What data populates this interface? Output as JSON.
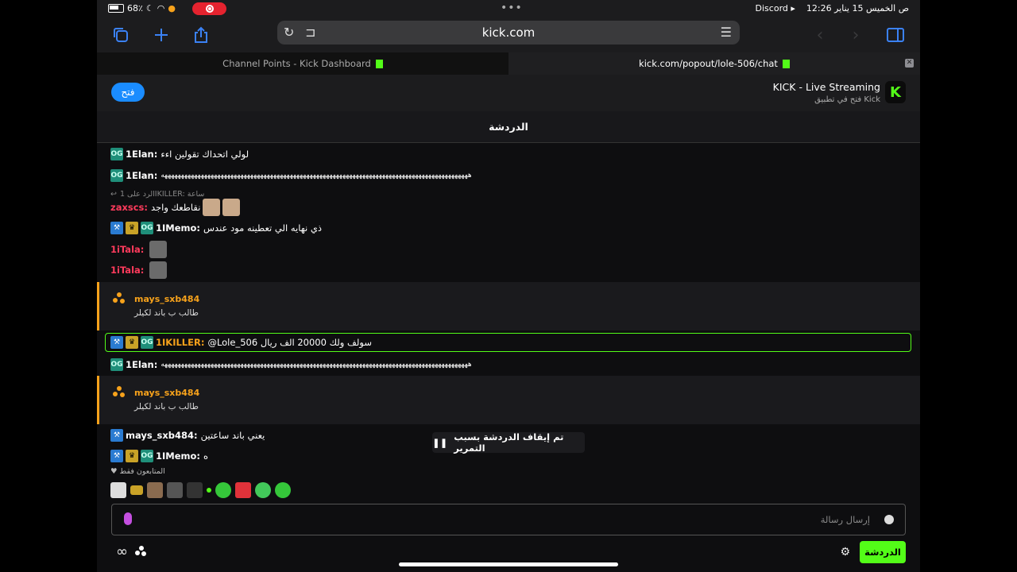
{
  "status": {
    "battery": "68٪",
    "time_date": "12:26 ص الخميس 15 يناير",
    "back_app": "Discord ▸",
    "dots": "•••"
  },
  "browser": {
    "url": "kick.com",
    "tabs": [
      "Channel Points - Kick Dashboard",
      "kick.com/popout/lole-506/chat"
    ],
    "tab_close": "✕"
  },
  "banner": {
    "open_label": "فتح",
    "title": "KICK - Live Streaming",
    "subtitle": "فتح في تطبيق Kick",
    "logo_letter": "K"
  },
  "chat": {
    "title": "الدردشة",
    "messages": [
      {
        "user": "1Elan:",
        "text": "لولي اتحداك تقولين اءء"
      },
      {
        "user": "1Elan:",
        "text": "هههههههههههههههههههههههههههههههههههههههههههههههههههههههههههههههههههههههههههههههههههههههههههههه"
      },
      {
        "reply": "الرد على 1IKILLER: ساعة",
        "user": "zaxscs:",
        "text": "نقاطعك واجد"
      },
      {
        "user": "1IMemo:",
        "text": "ذي نهايه الي تعطينه مود عندس"
      },
      {
        "user": "1iTala:",
        "text": ""
      },
      {
        "user": "1iTala:",
        "text": ""
      },
      {
        "user": "mays_sxb484",
        "text": "طالب ب باند لكيلر"
      },
      {
        "user": "1IKILLER:",
        "text": "@Lole_506 سولف ولك 20000 الف ريال"
      },
      {
        "user": "1Elan:",
        "text": "هههههههههههههههههههههههههههههههههههههههههههههههههههههههههههههههههههههههههههههههههههههههههههههه"
      },
      {
        "user": "mays_sxb484",
        "text": "طالب ب باند لكيلر"
      },
      {
        "user": "mays_sxb484:",
        "text": "يعني باند ساعتين"
      },
      {
        "user": "1IMemo:",
        "text": "ه"
      }
    ],
    "paused_label": "تم إيقاف الدردشة بسبب التمرير",
    "followers_only": "المتابعون فقط",
    "input_placeholder": "إرسال رسالة",
    "send_label": "الدردشة"
  },
  "colors": {
    "kick_green": "#53fc18",
    "gift_orange": "#f7a21b",
    "open_blue": "#1a8cff"
  }
}
